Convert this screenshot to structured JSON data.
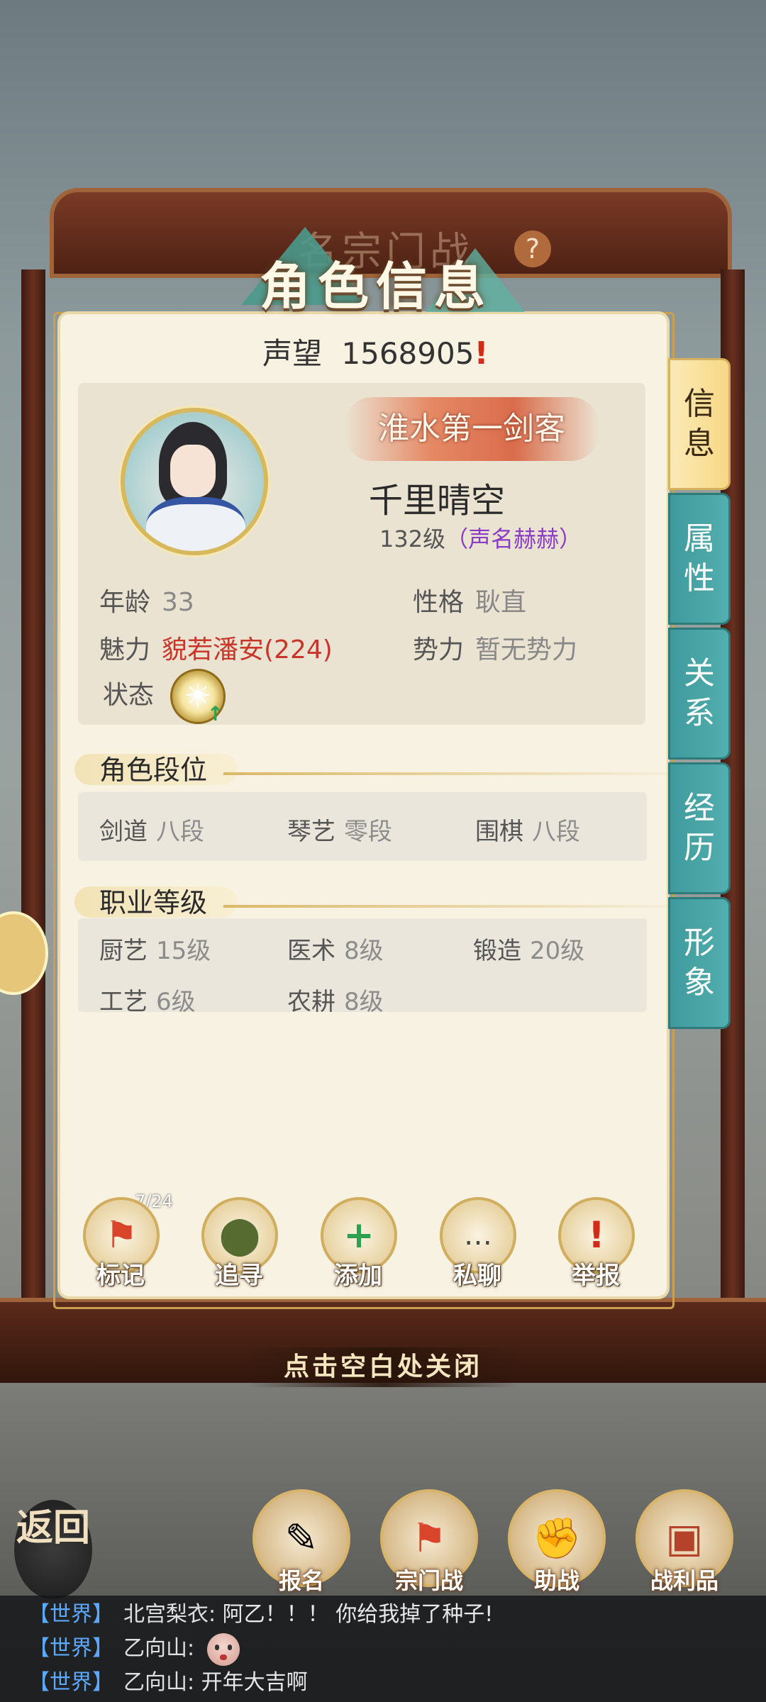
{
  "background": {
    "gate_title": "名宗门战",
    "help_mark": "?"
  },
  "panel": {
    "title": "角色信息",
    "reputation_label": "声望",
    "reputation_value": "1568905",
    "reputation_mark": "!",
    "character": {
      "title_badge": "淮水第一剑客",
      "name": "千里晴空",
      "level": "132级",
      "fame": "（声名赫赫）"
    },
    "attributes": {
      "age_label": "年龄",
      "age_value": "33",
      "personality_label": "性格",
      "personality_value": "耿直",
      "charm_label": "魅力",
      "charm_value": "貌若潘安(224)",
      "faction_label": "势力",
      "faction_value": "暂无势力",
      "status_label": "状态"
    },
    "rank_section": {
      "title": "角色段位",
      "items": [
        {
          "label": "剑道",
          "value": "八段"
        },
        {
          "label": "琴艺",
          "value": "零段"
        },
        {
          "label": "围棋",
          "value": "八段"
        }
      ]
    },
    "career_section": {
      "title": "职业等级",
      "items": [
        {
          "label": "厨艺",
          "value": "15级"
        },
        {
          "label": "医术",
          "value": "8级"
        },
        {
          "label": "锻造",
          "value": "20级"
        },
        {
          "label": "工艺",
          "value": "6级"
        },
        {
          "label": "农耕",
          "value": "8级"
        }
      ]
    },
    "actions": {
      "mark_count": "7/24",
      "items": [
        {
          "label": "标记",
          "icon": "flag-icon"
        },
        {
          "label": "追寻",
          "icon": "location-icon"
        },
        {
          "label": "添加",
          "icon": "add-friend-icon"
        },
        {
          "label": "私聊",
          "icon": "chat-icon"
        },
        {
          "label": "举报",
          "icon": "report-icon"
        }
      ]
    },
    "tabs": [
      {
        "label": "信息",
        "active": true
      },
      {
        "label": "属性",
        "active": false
      },
      {
        "label": "关系",
        "active": false
      },
      {
        "label": "经历",
        "active": false
      },
      {
        "label": "形象",
        "active": false
      }
    ]
  },
  "close_hint": "点击空白处关闭",
  "bottom_nav": {
    "back_label": "返回",
    "items": [
      {
        "label": "报名",
        "icon": "scroll-brush-icon"
      },
      {
        "label": "宗门战",
        "icon": "mountain-flag-icon"
      },
      {
        "label": "助战",
        "icon": "handshake-icon"
      },
      {
        "label": "战利品",
        "icon": "treasure-chest-icon"
      }
    ]
  },
  "chat": {
    "lines": [
      {
        "channel": "【世界】",
        "name": "北宫梨衣:",
        "text": "阿乙！！！ 你给我掉了种子!"
      },
      {
        "channel": "【世界】",
        "name": "乙向山:",
        "text": ""
      },
      {
        "channel": "【世界】",
        "name": "乙向山:",
        "text": "开年大吉啊"
      }
    ]
  },
  "colors": {
    "accent_teal": "#3e9a9c",
    "panel_bg": "#f8f2e3",
    "fame_purple": "#8a3cc4",
    "charm_red": "#c8362a",
    "chat_channel_blue": "#5ba9ff"
  }
}
